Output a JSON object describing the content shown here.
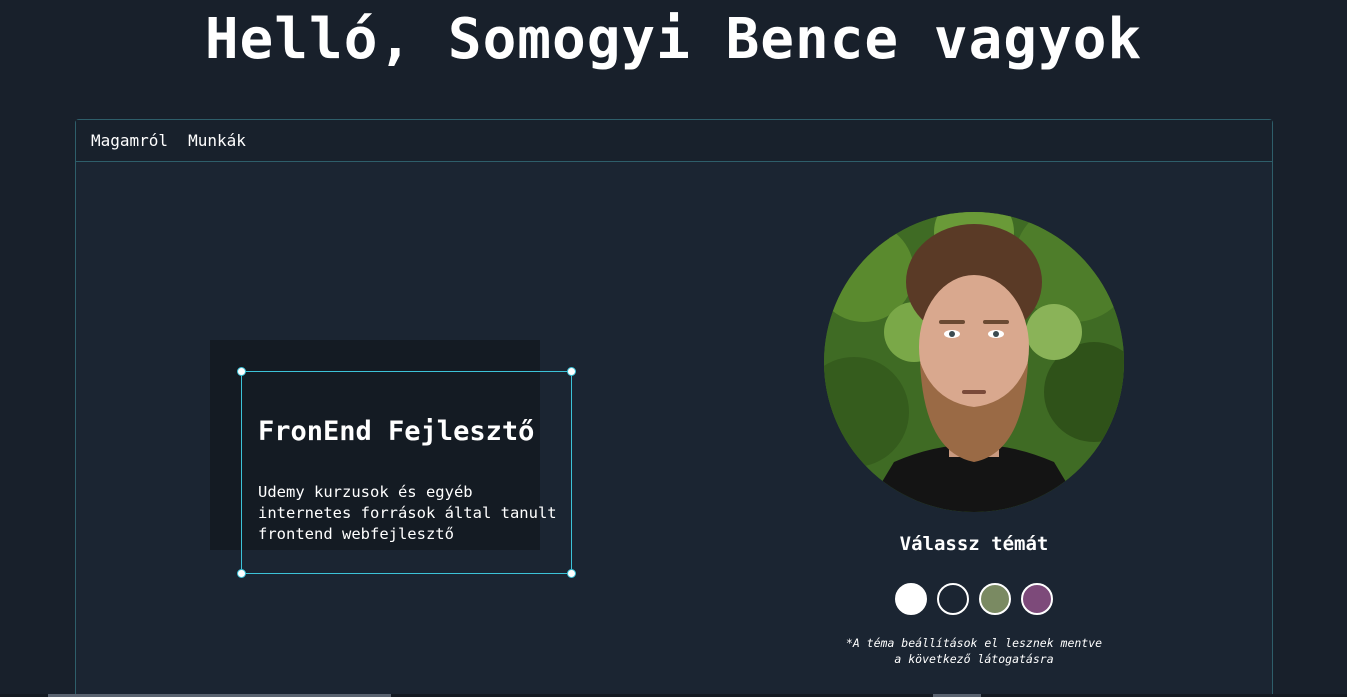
{
  "header": {
    "title": "Helló, Somogyi Bence vagyok"
  },
  "nav": {
    "items": [
      {
        "label": "Magamról"
      },
      {
        "label": "Munkák"
      }
    ]
  },
  "card": {
    "title": "FronEnd Fejlesztő",
    "description": "Udemy kurzusok és egyéb internetes források által tanult frontend webfejlesztő"
  },
  "profile": {
    "photo_icon": "profile-photo"
  },
  "theme": {
    "title": "Válassz témát",
    "swatches": [
      {
        "name": "white",
        "color": "#ffffff"
      },
      {
        "name": "dark",
        "color": "#1b2532"
      },
      {
        "name": "sage",
        "color": "#7a8a62"
      },
      {
        "name": "purple",
        "color": "#7d4a7a"
      }
    ],
    "note_line1": "*A téma beállítások el lesznek mentve",
    "note_line2": "a következő látogatásra"
  },
  "colors": {
    "background": "#18202b",
    "panel": "#1b2532",
    "accent_border": "#3cc3d8"
  }
}
